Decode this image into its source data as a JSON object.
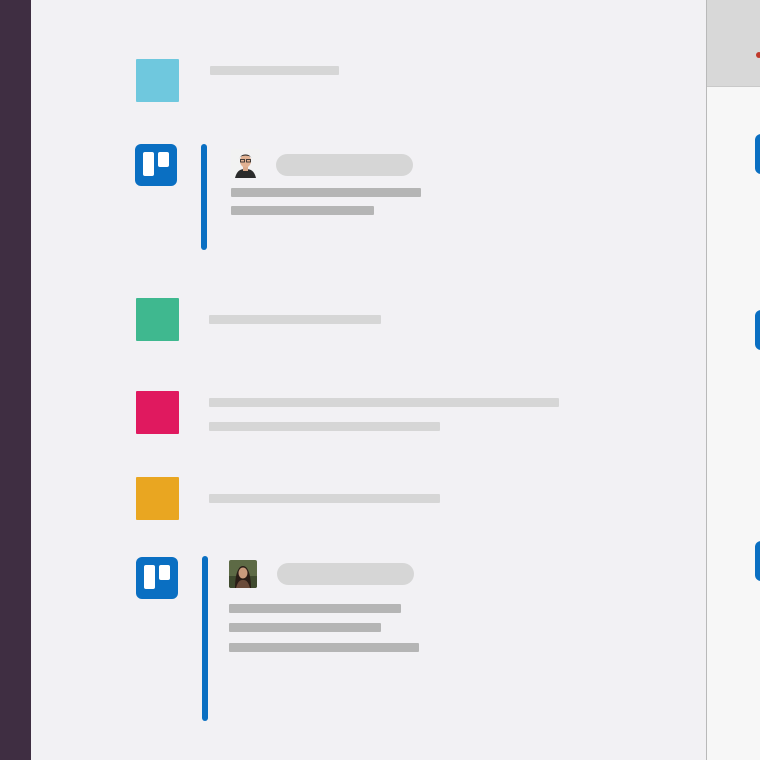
{
  "colors": {
    "sidebar": "#3f2e42",
    "trello_blue": "#0a6fc2",
    "square_cyan": "#6fc8de",
    "square_green": "#3fb88f",
    "square_pink": "#e0195f",
    "square_yellow": "#e9a621",
    "placeholder_bar": "#d6d6d6",
    "placeholder_bar_dark": "#b5b5b5"
  },
  "icons": {
    "app": "trello-icon",
    "user_1": "user-avatar",
    "user_2": "user-avatar"
  }
}
